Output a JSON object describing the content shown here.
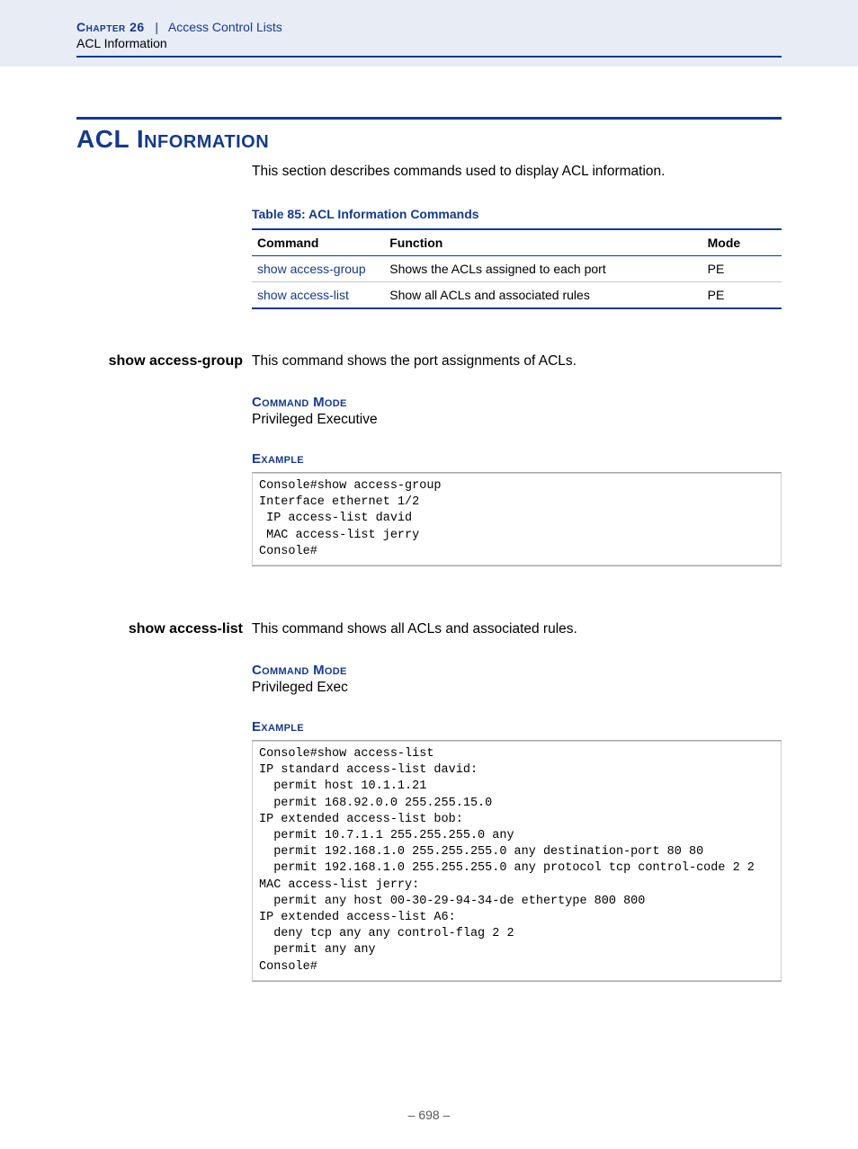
{
  "header": {
    "chapter_label": "Chapter 26",
    "separator": "|",
    "chapter_title": "Access Control Lists",
    "subsection": "ACL Information"
  },
  "section": {
    "heading": "ACL Information",
    "intro": "This section describes commands used to display ACL information."
  },
  "table": {
    "caption": "Table 85: ACL Information Commands",
    "headers": {
      "command": "Command",
      "function": "Function",
      "mode": "Mode"
    },
    "rows": [
      {
        "command": "show access-group",
        "function": "Shows the ACLs assigned to each port",
        "mode": "PE"
      },
      {
        "command": "show access-list",
        "function": "Show all ACLs and associated rules",
        "mode": "PE"
      }
    ]
  },
  "cmd1": {
    "name": "show access-group",
    "description": "This command shows the port assignments of ACLs.",
    "command_mode_label": "Command Mode",
    "command_mode": "Privileged Executive",
    "example_label": "Example",
    "example": "Console#show access-group\nInterface ethernet 1/2\n IP access-list david\n MAC access-list jerry\nConsole#"
  },
  "cmd2": {
    "name": "show access-list",
    "description": "This command shows all ACLs and associated rules.",
    "command_mode_label": "Command Mode",
    "command_mode": "Privileged Exec",
    "example_label": "Example",
    "example": "Console#show access-list\nIP standard access-list david:\n  permit host 10.1.1.21\n  permit 168.92.0.0 255.255.15.0\nIP extended access-list bob:\n  permit 10.7.1.1 255.255.255.0 any\n  permit 192.168.1.0 255.255.255.0 any destination-port 80 80\n  permit 192.168.1.0 255.255.255.0 any protocol tcp control-code 2 2\nMAC access-list jerry:\n  permit any host 00-30-29-94-34-de ethertype 800 800\nIP extended access-list A6:\n  deny tcp any any control-flag 2 2\n  permit any any\nConsole#"
  },
  "page_number": "– 698 –"
}
